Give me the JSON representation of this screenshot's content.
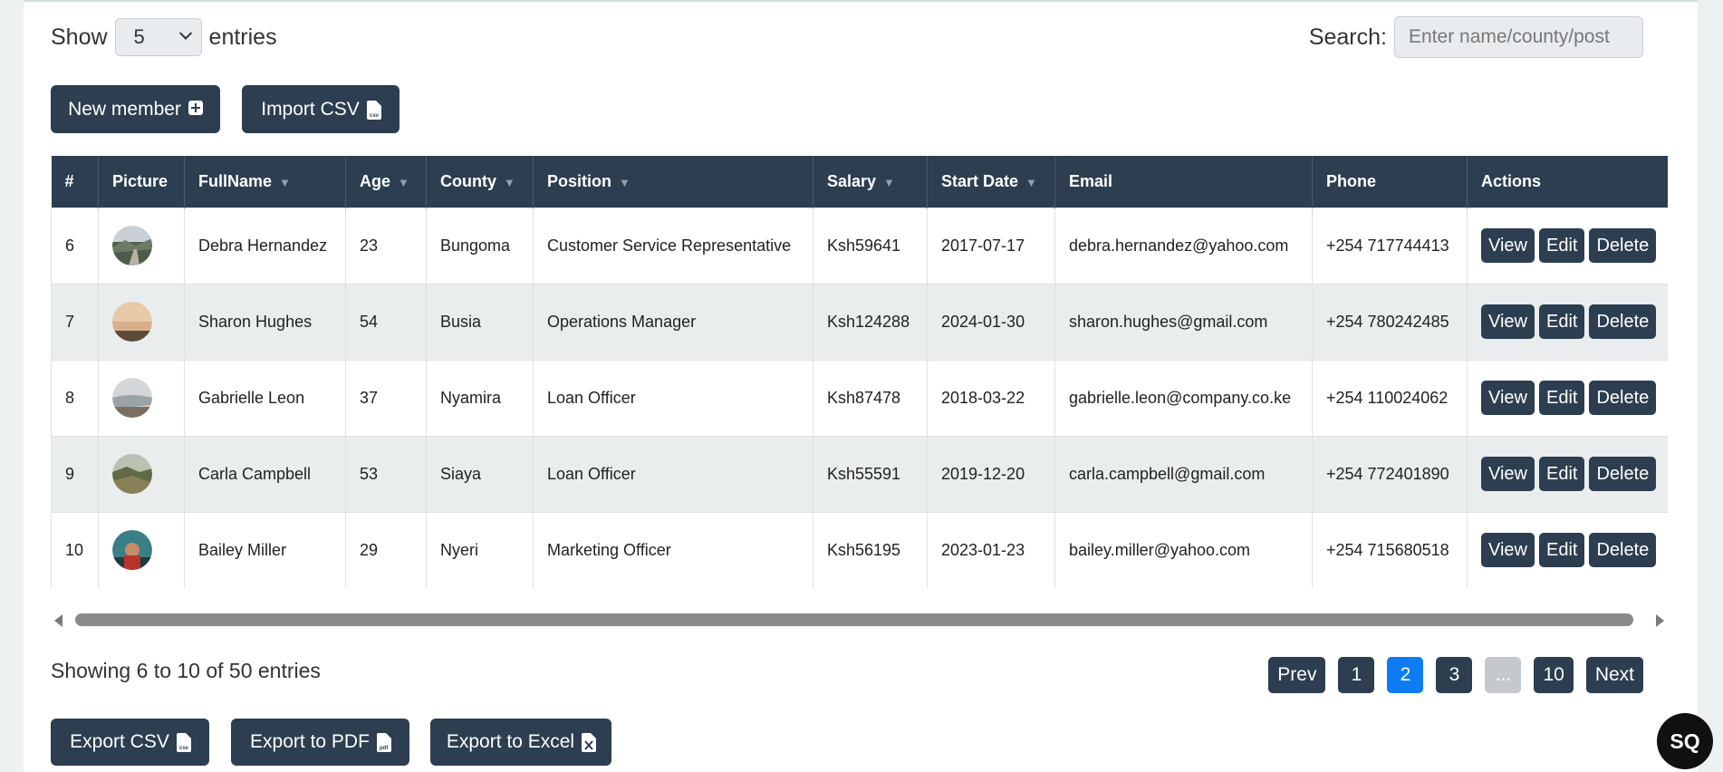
{
  "controls": {
    "show_label": "Show",
    "entries_label": "entries",
    "page_size": "5",
    "search_label": "Search:",
    "search_placeholder": "Enter name/county/post"
  },
  "toolbar": {
    "new_member": "New member",
    "import_csv": "Import CSV"
  },
  "table": {
    "columns": [
      "#",
      "Picture",
      "FullName",
      "Age",
      "County",
      "Position",
      "Salary",
      "Start Date",
      "Email",
      "Phone",
      "Actions"
    ],
    "rows": [
      {
        "id": "6",
        "avatar": "landscape-road",
        "name": "Debra Hernandez",
        "age": "23",
        "county": "Bungoma",
        "position": "Customer Service Representative",
        "salary": "Ksh59641",
        "start": "2017-07-17",
        "email": "debra.hernandez@yahoo.com",
        "phone": "+254 717744413"
      },
      {
        "id": "7",
        "avatar": "sunset-beach",
        "name": "Sharon Hughes",
        "age": "54",
        "county": "Busia",
        "position": "Operations Manager",
        "salary": "Ksh124288",
        "start": "2024-01-30",
        "email": "sharon.hughes@gmail.com",
        "phone": "+254 780242485"
      },
      {
        "id": "8",
        "avatar": "misty-coast",
        "name": "Gabrielle Leon",
        "age": "37",
        "county": "Nyamira",
        "position": "Loan Officer",
        "salary": "Ksh87478",
        "start": "2018-03-22",
        "email": "gabrielle.leon@company.co.ke",
        "phone": "+254 110024062"
      },
      {
        "id": "9",
        "avatar": "green-hills",
        "name": "Carla Campbell",
        "age": "53",
        "county": "Siaya",
        "position": "Loan Officer",
        "salary": "Ksh55591",
        "start": "2019-12-20",
        "email": "carla.campbell@gmail.com",
        "phone": "+254 772401890"
      },
      {
        "id": "10",
        "avatar": "person-portrait",
        "name": "Bailey Miller",
        "age": "29",
        "county": "Nyeri",
        "position": "Marketing Officer",
        "salary": "Ksh56195",
        "start": "2023-01-23",
        "email": "bailey.miller@yahoo.com",
        "phone": "+254 715680518"
      }
    ],
    "actions": {
      "view": "View",
      "edit": "Edit",
      "delete": "Delete"
    }
  },
  "footer": {
    "info": "Showing 6 to 10 of 50 entries",
    "pagination": {
      "prev": "Prev",
      "pages": [
        "1",
        "2",
        "3",
        "...",
        "10"
      ],
      "active": "2",
      "next": "Next"
    },
    "export_csv": "Export CSV",
    "export_pdf": "Export to PDF",
    "export_excel": "Export to Excel"
  },
  "fab_label": "SQ",
  "colors": {
    "primary_dark": "#2c3e50",
    "active_page": "#0d7cf2",
    "row_alt": "#e9edee"
  }
}
